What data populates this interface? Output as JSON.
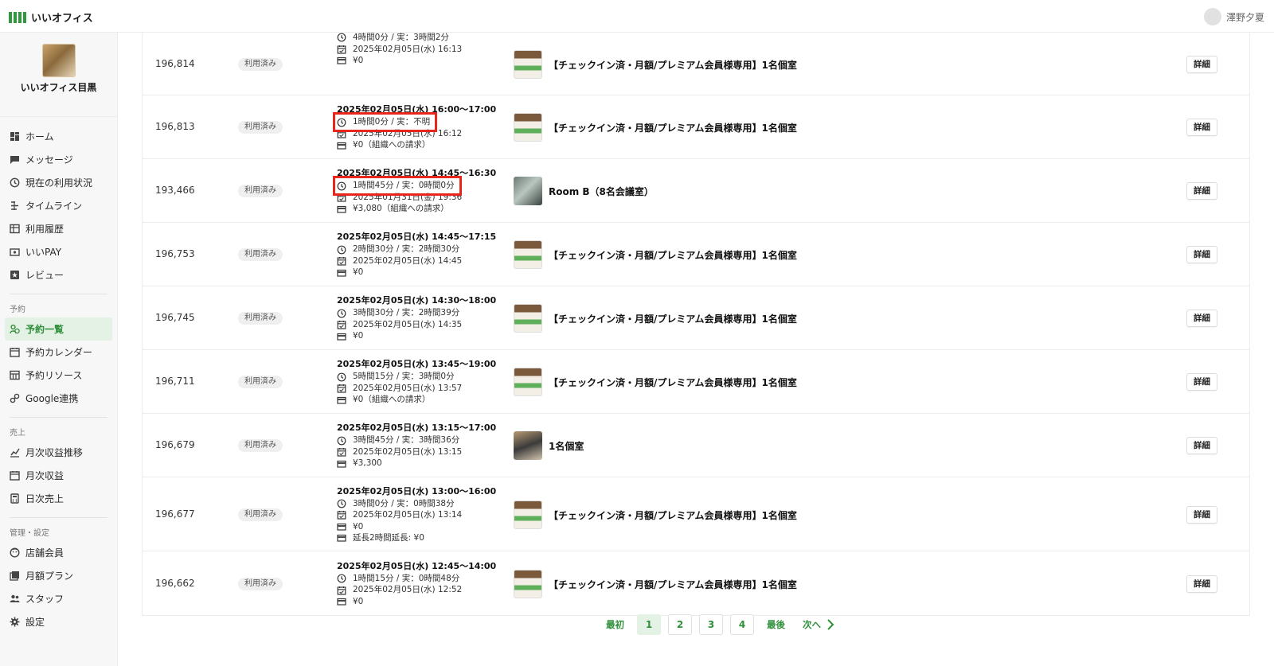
{
  "app": {
    "name": "いいオフィス"
  },
  "user": {
    "name": "澤野夕夏"
  },
  "shop": {
    "name": "いいオフィス目黒"
  },
  "colors": {
    "accent": "#2f8f3a",
    "active_bg": "#e4f1e5",
    "highlight": "#e8261c"
  },
  "sidebar": {
    "main": [
      {
        "label": "ホーム",
        "icon": "dashboard-icon"
      },
      {
        "label": "メッセージ",
        "icon": "message-icon"
      },
      {
        "label": "現在の利用状況",
        "icon": "clock-icon"
      },
      {
        "label": "タイムライン",
        "icon": "timeline-icon"
      },
      {
        "label": "利用履歴",
        "icon": "table-icon"
      },
      {
        "label": "いいPAY",
        "icon": "wallet-icon"
      },
      {
        "label": "レビュー",
        "icon": "star-icon"
      }
    ],
    "sections": [
      {
        "title": "予約",
        "items": [
          {
            "label": "予約一覧",
            "icon": "reservation-list-icon",
            "active": true
          },
          {
            "label": "予約カレンダー",
            "icon": "calendar-icon"
          },
          {
            "label": "予約リソース",
            "icon": "resource-icon"
          },
          {
            "label": "Google連携",
            "icon": "link-icon"
          }
        ]
      },
      {
        "title": "売上",
        "items": [
          {
            "label": "月次収益推移",
            "icon": "chart-icon"
          },
          {
            "label": "月次収益",
            "icon": "calendar-icon"
          },
          {
            "label": "日次売上",
            "icon": "calculator-icon"
          }
        ]
      },
      {
        "title": "管理・設定",
        "items": [
          {
            "label": "店舗会員",
            "icon": "member-icon"
          },
          {
            "label": "月額プラン",
            "icon": "plan-icon"
          },
          {
            "label": "スタッフ",
            "icon": "staff-icon"
          },
          {
            "label": "設定",
            "icon": "gear-icon"
          }
        ]
      }
    ]
  },
  "detail_label": "詳細",
  "rows": [
    {
      "id": "196,814",
      "status": "利用済み",
      "datetime": "",
      "duration": "4時間0分 / 実：3時間2分",
      "booked": "2025年02月05日(水) 16:13",
      "price": "¥0",
      "extra": "",
      "room": "【チェックイン済・月額/プレミアム会員様専用】1名個室",
      "thumb": "poster",
      "highlight": false
    },
    {
      "id": "196,813",
      "status": "利用済み",
      "datetime": "2025年02月05日(水) 16:00〜17:00",
      "duration": "1時間0分 / 実：不明",
      "booked": "2025年02月05日(水) 16:12",
      "price": "¥0（組織への請求）",
      "extra": "",
      "room": "【チェックイン済・月額/プレミアム会員様専用】1名個室",
      "thumb": "poster",
      "highlight": true
    },
    {
      "id": "193,466",
      "status": "利用済み",
      "datetime": "2025年02月05日(水) 14:45〜16:30",
      "duration": "1時間45分 / 実：0時間0分",
      "booked": "2025年01月31日(金) 19:36",
      "price": "¥3,080（組織への請求）",
      "extra": "",
      "room": "Room B（8名会議室）",
      "thumb": "room",
      "highlight": true
    },
    {
      "id": "196,753",
      "status": "利用済み",
      "datetime": "2025年02月05日(水) 14:45〜17:15",
      "duration": "2時間30分 / 実：2時間30分",
      "booked": "2025年02月05日(水) 14:45",
      "price": "¥0",
      "extra": "",
      "room": "【チェックイン済・月額/プレミアム会員様専用】1名個室",
      "thumb": "poster",
      "highlight": false
    },
    {
      "id": "196,745",
      "status": "利用済み",
      "datetime": "2025年02月05日(水) 14:30〜18:00",
      "duration": "3時間30分 / 実：2時間39分",
      "booked": "2025年02月05日(水) 14:35",
      "price": "¥0",
      "extra": "",
      "room": "【チェックイン済・月額/プレミアム会員様専用】1名個室",
      "thumb": "poster",
      "highlight": false
    },
    {
      "id": "196,711",
      "status": "利用済み",
      "datetime": "2025年02月05日(水) 13:45〜19:00",
      "duration": "5時間15分 / 実：3時間0分",
      "booked": "2025年02月05日(水) 13:57",
      "price": "¥0（組織への請求）",
      "extra": "",
      "room": "【チェックイン済・月額/プレミアム会員様専用】1名個室",
      "thumb": "poster",
      "highlight": false
    },
    {
      "id": "196,679",
      "status": "利用済み",
      "datetime": "2025年02月05日(水) 13:15〜17:00",
      "duration": "3時間45分 / 実：3時間36分",
      "booked": "2025年02月05日(水) 13:15",
      "price": "¥3,300",
      "extra": "",
      "room": "1名個室",
      "thumb": "desk",
      "highlight": false
    },
    {
      "id": "196,677",
      "status": "利用済み",
      "datetime": "2025年02月05日(水) 13:00〜16:00",
      "duration": "3時間0分 / 実：0時間38分",
      "booked": "2025年02月05日(水) 13:14",
      "price": "¥0",
      "extra": "延長2時間延長: ¥0",
      "room": "【チェックイン済・月額/プレミアム会員様専用】1名個室",
      "thumb": "poster",
      "highlight": false
    },
    {
      "id": "196,662",
      "status": "利用済み",
      "datetime": "2025年02月05日(水) 12:45〜14:00",
      "duration": "1時間15分 / 実：0時間48分",
      "booked": "2025年02月05日(水) 12:52",
      "price": "¥0",
      "extra": "",
      "room": "【チェックイン済・月額/プレミアム会員様専用】1名個室",
      "thumb": "poster",
      "highlight": false
    }
  ],
  "pagination": {
    "first": "最初",
    "pages": [
      "1",
      "2",
      "3",
      "4"
    ],
    "current": "1",
    "last": "最後",
    "next": "次へ"
  }
}
